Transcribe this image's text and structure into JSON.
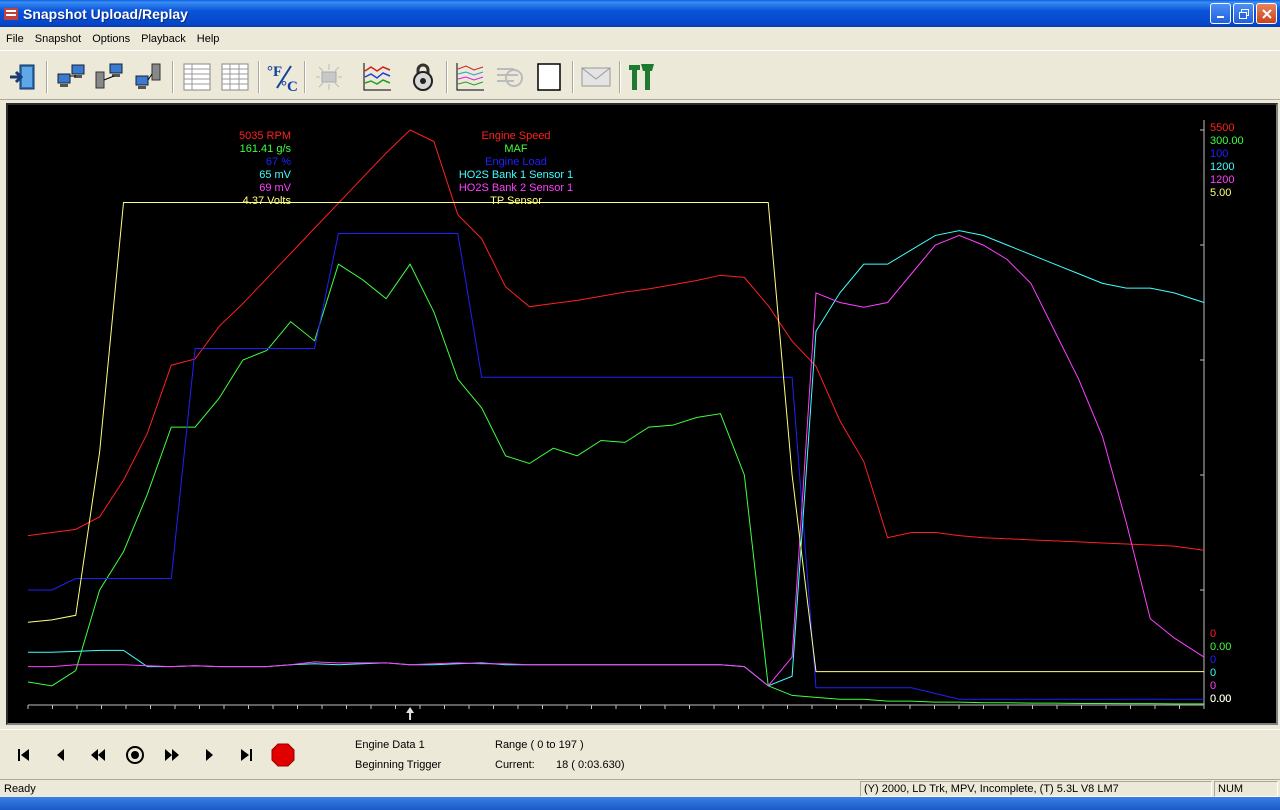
{
  "window": {
    "title": "Snapshot Upload/Replay"
  },
  "menu": [
    "File",
    "Snapshot",
    "Options",
    "Playback",
    "Help"
  ],
  "toolbar": {
    "icons": [
      "exit-icon",
      "upload-snapshot-icon",
      "download-snapshot-icon",
      "transfer-icon",
      "grid-view-icon",
      "grid-view-2-icon",
      "temperature-units-icon",
      "disabled-device-icon",
      "graph-view-icon",
      "lock-icon",
      "multi-graph-icon",
      "replay-disabled-icon",
      "page-icon",
      "mail-icon",
      "tools-icon"
    ],
    "temp_label": "°F/°C"
  },
  "legend": [
    {
      "value": "5035",
      "unit": "RPM",
      "name": "Engine Speed",
      "color": "#ff2020"
    },
    {
      "value": "161.41",
      "unit": "g/s",
      "name": "MAF",
      "color": "#40ff40"
    },
    {
      "value": "67",
      "unit": "%",
      "name": "Engine Load",
      "color": "#2020ff"
    },
    {
      "value": "65",
      "unit": "mV",
      "name": "HO2S Bank 1 Sensor 1",
      "color": "#40ffff"
    },
    {
      "value": "69",
      "unit": "mV",
      "name": "HO2S Bank 2 Sensor 1",
      "color": "#ff40ff"
    },
    {
      "value": "4.37",
      "unit": "Volts",
      "name": "TP Sensor",
      "color": "#ffff80"
    }
  ],
  "scale_max": [
    "5500",
    "300.00",
    "100",
    "1200",
    "1200",
    "5.00"
  ],
  "scale_min": [
    "0",
    "0.00",
    "0",
    "0",
    "0",
    "0.00"
  ],
  "chart_data": {
    "type": "line",
    "x": [
      0,
      4,
      8,
      12,
      16,
      20,
      24,
      28,
      32,
      36,
      40,
      44,
      48,
      52,
      56,
      60,
      64,
      68,
      72,
      76,
      80,
      84,
      88,
      92,
      96,
      100,
      104,
      108,
      112,
      116,
      120,
      124,
      128,
      132,
      136,
      140,
      144,
      148,
      152,
      156,
      160,
      164,
      168,
      172,
      176,
      180,
      184,
      188,
      192,
      197
    ],
    "series": [
      {
        "name": "Engine Speed",
        "values": [
          1620,
          1650,
          1680,
          1800,
          2150,
          2600,
          3250,
          3310,
          3620,
          3840,
          4080,
          4320,
          4560,
          4800,
          5040,
          5280,
          5500,
          5390,
          4690,
          4460,
          4000,
          3810,
          3840,
          3870,
          3910,
          3950,
          3980,
          4020,
          4060,
          4110,
          4090,
          3820,
          3480,
          3240,
          2720,
          2330,
          1600,
          1650,
          1650,
          1620,
          1600,
          1590,
          1580,
          1570,
          1560,
          1550,
          1540,
          1530,
          1520,
          1480
        ]
      },
      {
        "name": "MAF",
        "values": [
          12,
          10,
          18,
          60,
          80,
          110,
          145,
          145,
          160,
          180,
          185,
          200,
          190,
          230,
          222,
          212,
          230,
          205,
          170,
          155,
          130,
          126,
          134,
          130,
          138,
          137,
          145,
          146,
          150,
          152,
          120,
          10,
          5,
          4,
          3,
          3,
          2,
          2,
          1.5,
          1.5,
          1.2,
          1.2,
          1.0,
          1.0,
          0.8,
          0.8,
          0.7,
          0.7,
          0.6,
          0.6
        ]
      },
      {
        "name": "Engine Load",
        "values": [
          20,
          20,
          22,
          22,
          22,
          22,
          22,
          62,
          62,
          62,
          62,
          62,
          62,
          82,
          82,
          82,
          82,
          82,
          82,
          57,
          57,
          57,
          57,
          57,
          57,
          57,
          57,
          57,
          57,
          57,
          57,
          57,
          57,
          3,
          3,
          3,
          3,
          3,
          2,
          1,
          1,
          1,
          1,
          1,
          1,
          1,
          1,
          1,
          1,
          1
        ]
      },
      {
        "name": "HO2S Bank 1 Sensor 1",
        "values": [
          110,
          110,
          112,
          114,
          114,
          80,
          80,
          82,
          80,
          80,
          80,
          84,
          86,
          84,
          86,
          88,
          84,
          84,
          86,
          88,
          84,
          84,
          84,
          84,
          84,
          84,
          84,
          84,
          84,
          84,
          80,
          40,
          60,
          780,
          860,
          920,
          920,
          950,
          980,
          990,
          980,
          960,
          940,
          920,
          900,
          880,
          870,
          870,
          860,
          840
        ]
      },
      {
        "name": "HO2S Bank 2 Sensor 1",
        "values": [
          80,
          80,
          84,
          84,
          84,
          82,
          80,
          82,
          80,
          80,
          80,
          84,
          90,
          88,
          88,
          88,
          84,
          86,
          88,
          86,
          86,
          84,
          84,
          84,
          84,
          84,
          84,
          84,
          84,
          84,
          80,
          40,
          100,
          860,
          840,
          830,
          840,
          900,
          960,
          980,
          960,
          930,
          880,
          780,
          680,
          560,
          380,
          180,
          140,
          100
        ]
      },
      {
        "name": "TP Sensor",
        "values": [
          0.72,
          0.74,
          0.78,
          2.2,
          4.37,
          4.37,
          4.37,
          4.37,
          4.37,
          4.37,
          4.37,
          4.37,
          4.37,
          4.37,
          4.37,
          4.37,
          4.37,
          4.37,
          4.37,
          4.37,
          4.37,
          4.37,
          4.37,
          4.37,
          4.37,
          4.37,
          4.37,
          4.37,
          4.37,
          4.37,
          4.37,
          4.37,
          2.0,
          0.29,
          0.29,
          0.29,
          0.29,
          0.29,
          0.29,
          0.29,
          0.29,
          0.29,
          0.29,
          0.29,
          0.29,
          0.29,
          0.29,
          0.29,
          0.29,
          0.29
        ]
      }
    ],
    "cursor_x": 64,
    "xlim": [
      0,
      197
    ],
    "grid": false
  },
  "playback": {
    "buttons": [
      "first-frame-icon",
      "step-back-icon",
      "fast-rewind-icon",
      "record-icon",
      "fast-forward-icon",
      "step-forward-icon",
      "last-frame-icon",
      "stop-icon"
    ],
    "engine_data": "Engine Data 1",
    "trigger": "Beginning Trigger",
    "range": "Range ( 0 to 197 )",
    "current_label": "Current:",
    "current_value": "18 ( 0:03.630)"
  },
  "status": {
    "ready": "Ready",
    "vehicle": "(Y) 2000, LD Trk, MPV, Incomplete, (T) 5.3L   V8 LM7",
    "num": "NUM"
  }
}
